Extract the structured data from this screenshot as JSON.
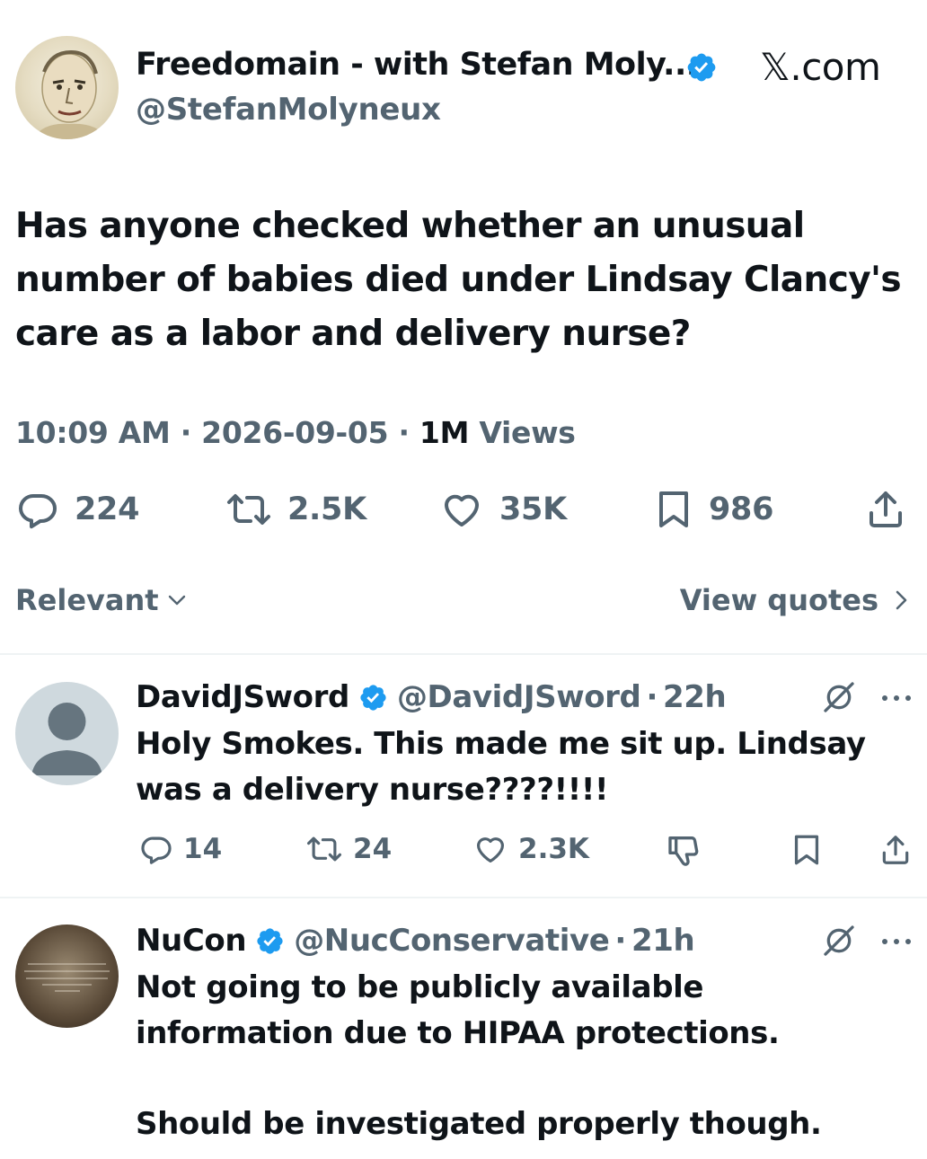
{
  "tweet": {
    "author_name": "Freedomain - with Stefan Moly...",
    "handle": "@StefanMolyneux",
    "site_label": "𝕏.com",
    "text": "Has anyone checked whether an unusual number of babies died under Lindsay Clancy's care as a labor and delivery nurse?",
    "time": "10:09 AM",
    "date": "2026-09-05",
    "views_count": "1M",
    "views_label": "Views",
    "separator": "·",
    "stats": {
      "replies": "224",
      "reposts": "2.5K",
      "likes": "35K",
      "bookmarks": "986"
    }
  },
  "filter": {
    "sort_label": "Relevant",
    "view_quotes_label": "View quotes"
  },
  "replies": [
    {
      "name": "DavidJSword",
      "handle": "@DavidJSword",
      "time": "22h",
      "text": "Holy Smokes. This made me sit up. Lindsay was a delivery nurse????!!!!",
      "stats": {
        "replies": "14",
        "reposts": "24",
        "likes": "2.3K"
      }
    },
    {
      "name": "NuCon",
      "handle": "@NucConservative",
      "time": "21h",
      "text_line1": "Not going to be publicly available information due to HIPAA protections.",
      "text_line2": "Should be investigated properly though."
    }
  ],
  "colors": {
    "verified": "#1d9bf0",
    "muted": "#536471",
    "text": "#0f1419",
    "divider": "#eff3f4"
  },
  "icons": [
    "verified-badge-icon",
    "reply-icon",
    "repost-icon",
    "like-icon",
    "bookmark-icon",
    "share-icon",
    "chevron-down-icon",
    "chevron-right-icon",
    "grok-icon",
    "more-icon",
    "downvote-icon"
  ]
}
